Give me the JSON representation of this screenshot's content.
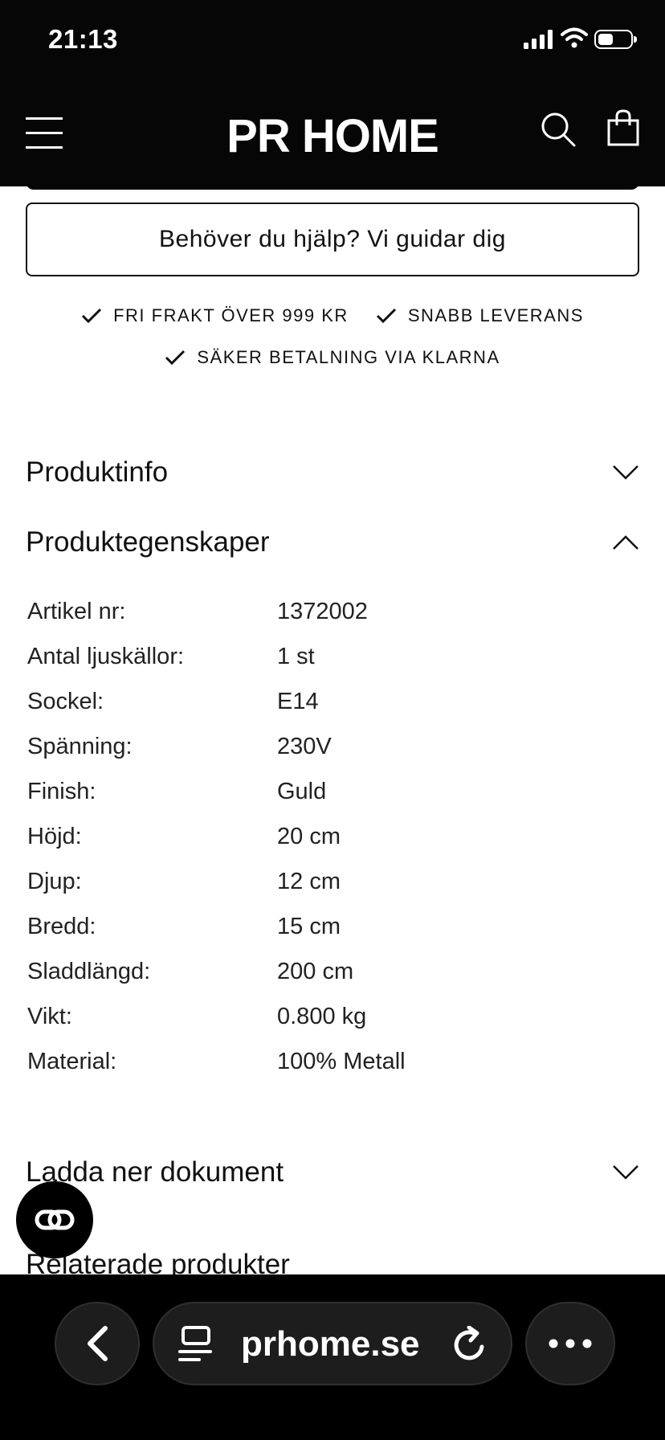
{
  "status_bar": {
    "time": "21:13"
  },
  "header": {
    "logo": "PR HOME"
  },
  "help_button": {
    "label": "Behöver du hjälp? Vi guidar dig"
  },
  "usps": [
    {
      "label": "FRI FRAKT ÖVER 999 KR"
    },
    {
      "label": "SNABB LEVERANS"
    },
    {
      "label": "SÄKER BETALNING VIA KLARNA"
    }
  ],
  "accordions": {
    "product_info": "Produktinfo",
    "product_properties": "Produktegenskaper",
    "download_docs": "Ladda ner dokument",
    "related_products": "Relaterade produkter"
  },
  "specs": [
    {
      "key": "Artikel nr:",
      "value": "1372002"
    },
    {
      "key": "Antal ljuskällor:",
      "value": "1 st"
    },
    {
      "key": "Sockel:",
      "value": "E14"
    },
    {
      "key": "Spänning:",
      "value": "230V"
    },
    {
      "key": "Finish:",
      "value": "Guld"
    },
    {
      "key": "Höjd:",
      "value": "20 cm"
    },
    {
      "key": "Djup:",
      "value": "12 cm"
    },
    {
      "key": "Bredd:",
      "value": "15 cm"
    },
    {
      "key": "Sladdlängd:",
      "value": "200 cm"
    },
    {
      "key": "Vikt:",
      "value": "0.800 kg"
    },
    {
      "key": "Material:",
      "value": "100% Metall"
    }
  ],
  "browser": {
    "url": "prhome.se"
  },
  "icons": {
    "menu": "hamburger-menu-icon",
    "search": "search-icon",
    "bag": "shopping-bag-icon",
    "check": "check-icon",
    "chat": "chat-icon",
    "back": "chevron-left-icon",
    "reader": "reader-mode-icon",
    "reload": "reload-icon",
    "more": "more-icon"
  }
}
